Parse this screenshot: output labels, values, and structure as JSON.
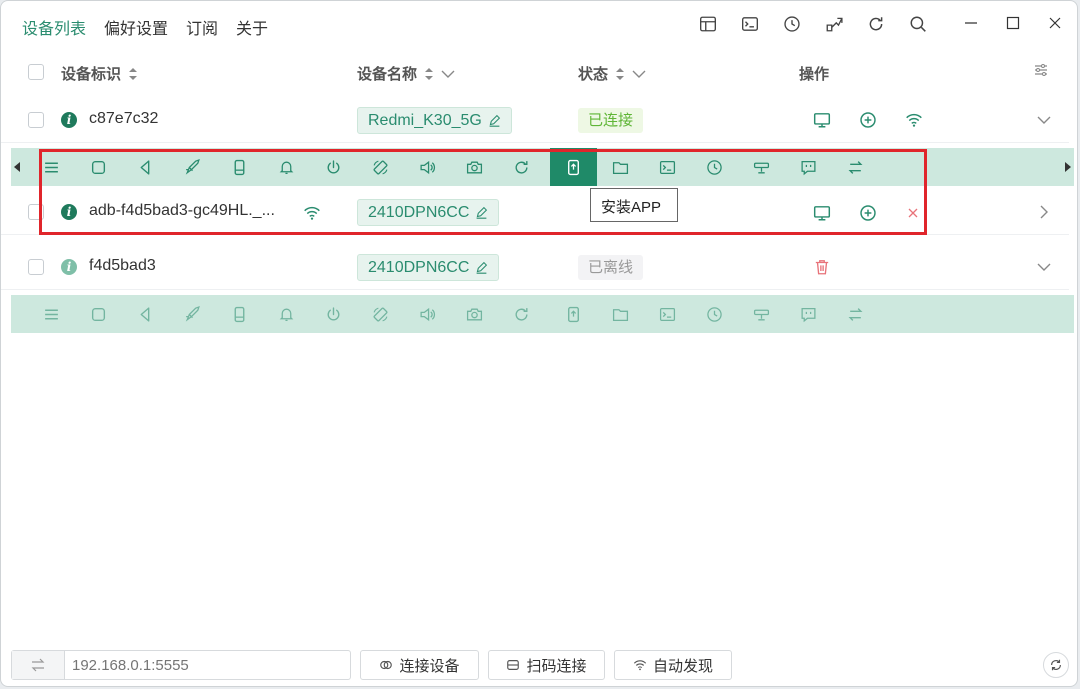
{
  "menu": [
    {
      "label": "设备列表",
      "active": true
    },
    {
      "label": "偏好设置",
      "active": false
    },
    {
      "label": "订阅",
      "active": false
    },
    {
      "label": "关于",
      "active": false
    }
  ],
  "table": {
    "headers": {
      "id": "设备标识",
      "name": "设备名称",
      "status": "状态",
      "actions": "操作"
    }
  },
  "devices": [
    {
      "serial": "c87e7c32",
      "name": "Redmi_K30_5G",
      "status": "已连接",
      "status_type": "connected"
    },
    {
      "serial": "adb-f4d5bad3-gc49HL._...",
      "name": "2410DPN6CC",
      "status": "",
      "status_type": "wifi"
    },
    {
      "serial": "f4d5bad3",
      "name": "2410DPN6CC",
      "status": "已离线",
      "status_type": "offline"
    }
  ],
  "tooltip": "安装APP",
  "bottom": {
    "ip_placeholder": "192.168.0.1:5555",
    "connect_label": "连接设备",
    "scan_label": "扫码连接",
    "discover_label": "自动发现"
  },
  "colors": {
    "accent": "#2a8c6f",
    "toolbar_bg": "#cde8de",
    "highlight": "#e0252b"
  }
}
